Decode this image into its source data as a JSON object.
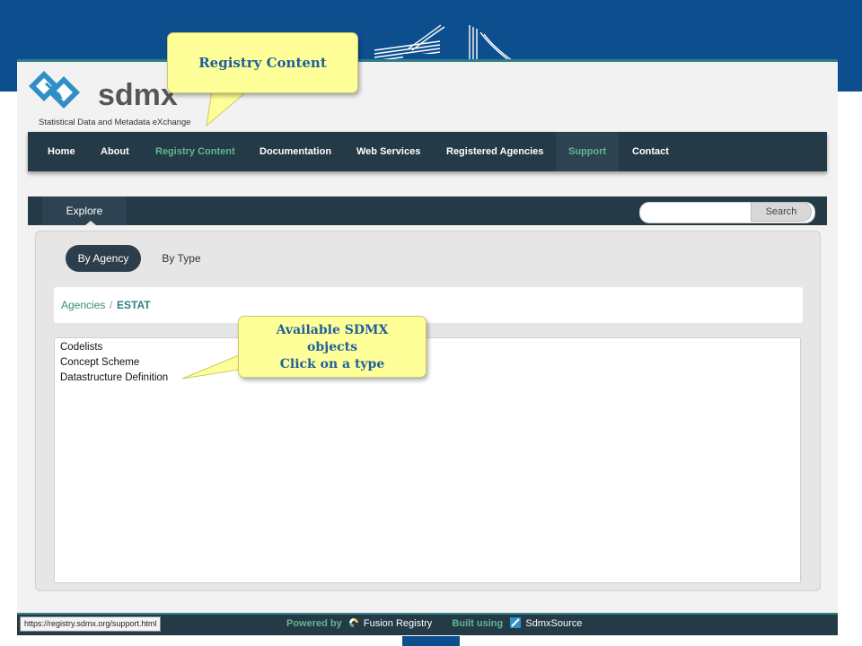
{
  "browser": {
    "status_url": "https://registry.sdmx.org/support.html"
  },
  "logo": {
    "name": "sdmx",
    "tagline": "Statistical Data and Metadata eXchange"
  },
  "nav": {
    "items": [
      {
        "label": "Home"
      },
      {
        "label": "About"
      },
      {
        "label": "Registry Content"
      },
      {
        "label": "Documentation"
      },
      {
        "label": "Web Services"
      },
      {
        "label": "Registered Agencies"
      },
      {
        "label": "Support"
      },
      {
        "label": "Contact"
      }
    ]
  },
  "panel": {
    "tab": "Explore",
    "search_button": "Search",
    "search_placeholder": "",
    "filters": [
      {
        "label": "By Agency",
        "selected": true
      },
      {
        "label": "By Type",
        "selected": false
      }
    ],
    "breadcrumb": {
      "root": "Agencies",
      "separator": "/",
      "current": "ESTAT"
    },
    "types": [
      "Codelists",
      "Concept Scheme",
      "Datastructure Definition"
    ]
  },
  "footer": {
    "powered_by": "Powered by",
    "fusion": "Fusion Registry",
    "built_using": "Built using",
    "sdmxsource": "SdmxSource"
  },
  "callouts": {
    "registry_content": "Registry Content",
    "available_line1": "Available SDMX",
    "available_line2": "objects",
    "available_line3": "Click on a type"
  },
  "colors": {
    "slide_blue": "#0d4f8e",
    "nav_bg": "#253a47",
    "accent_green": "#5fb88f",
    "callout_fill": "#ffff99",
    "callout_text": "#1f5f9a"
  }
}
